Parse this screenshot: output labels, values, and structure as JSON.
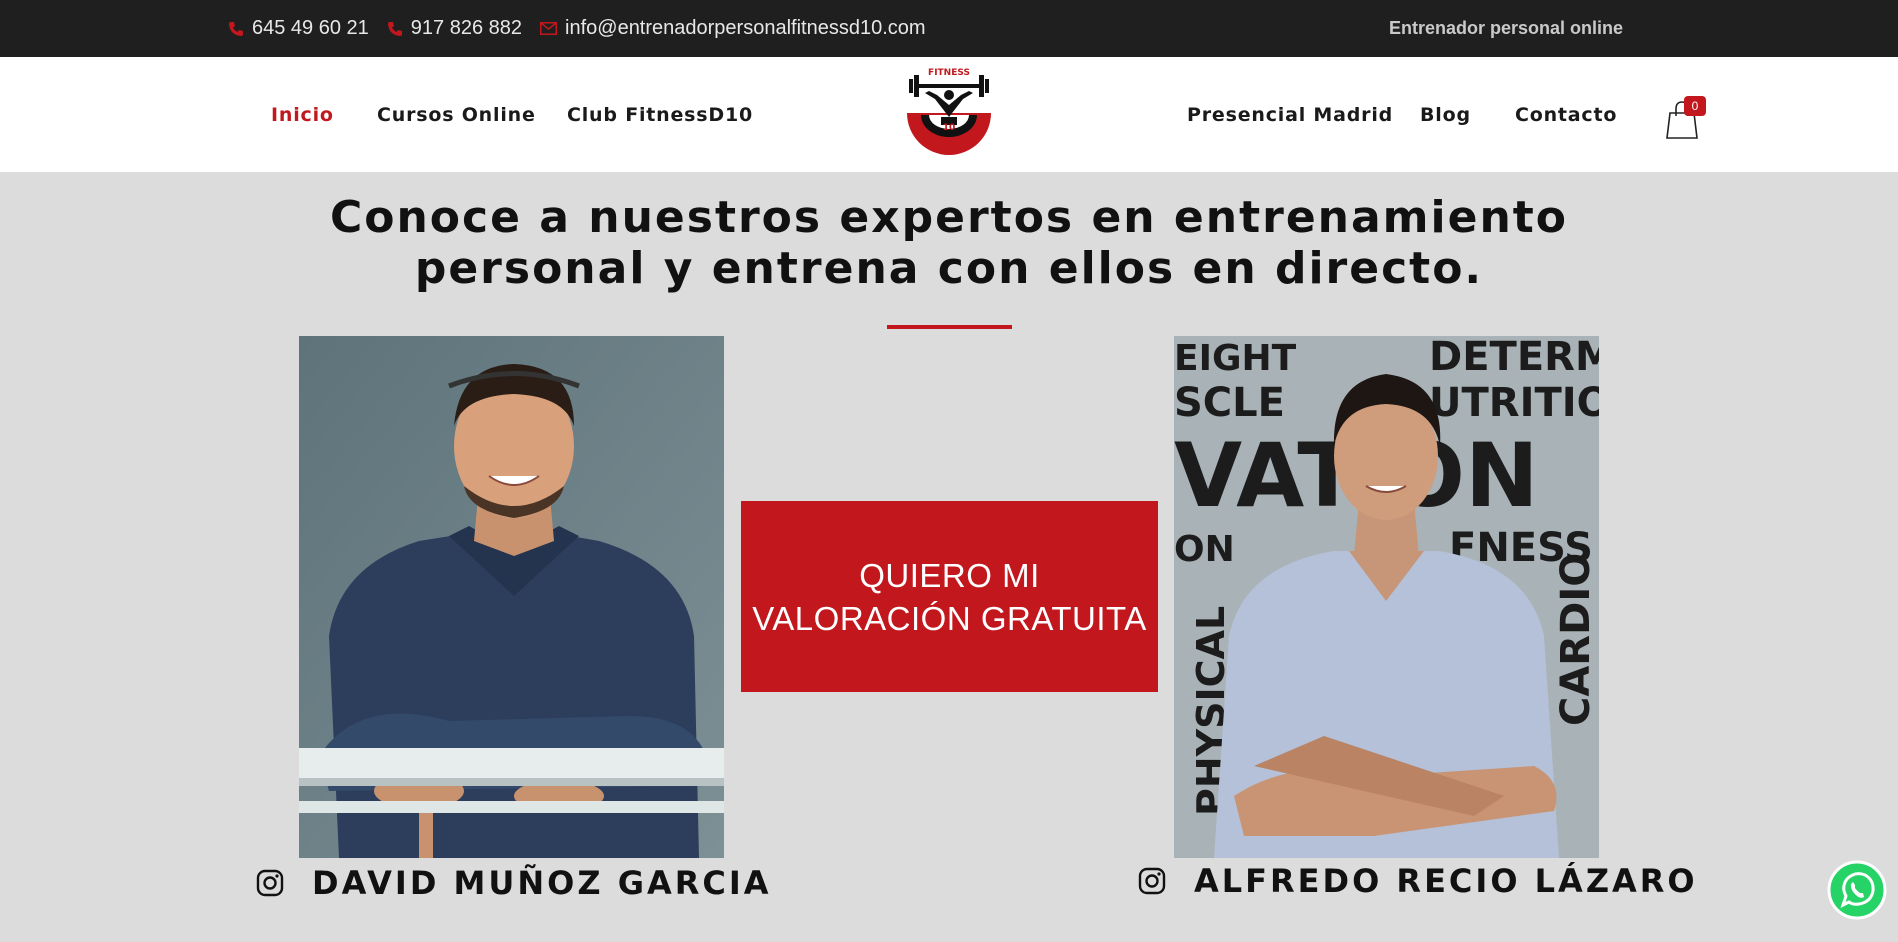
{
  "topbar": {
    "phone1": "645 49 60 21",
    "phone2": "917 826 882",
    "email": "info@entrenadorpersonalfitnessd10.com",
    "tagline": "Entrenador personal online",
    "phone_icon": "phone-icon",
    "email_icon": "envelope-icon"
  },
  "nav": {
    "left": [
      "Inicio",
      "Cursos Online",
      "Club FitnessD10"
    ],
    "right": [
      "Presencial Madrid",
      "Blog",
      "Contacto"
    ],
    "active": "Inicio",
    "cart_count": "0",
    "logo_text_top": "FITNESS",
    "logo_text_bottom": "10"
  },
  "hero": {
    "heading_line1": "Conoce a nuestros expertos en entrenamiento",
    "heading_line2": "personal y entrena con ellos en directo."
  },
  "cta": {
    "line1": "QUIERO MI",
    "line2": "VALORACIÓN GRATUITA"
  },
  "experts": [
    {
      "name": "DAVID MUÑOZ GARCIA",
      "icon": "instagram-icon"
    },
    {
      "name": "ALFREDO RECIO LÁZARO",
      "icon": "instagram-icon"
    }
  ],
  "wall_words": [
    "EIGHT",
    "DETERMI",
    "SCLE",
    "UTRITIO",
    "VATION",
    "FNESS",
    "ON",
    "PHYSICAL",
    "CARDIO"
  ],
  "colors": {
    "accent": "#c1171d",
    "topbar_bg": "#1f1f1f",
    "page_bg": "#dcdcdc"
  }
}
